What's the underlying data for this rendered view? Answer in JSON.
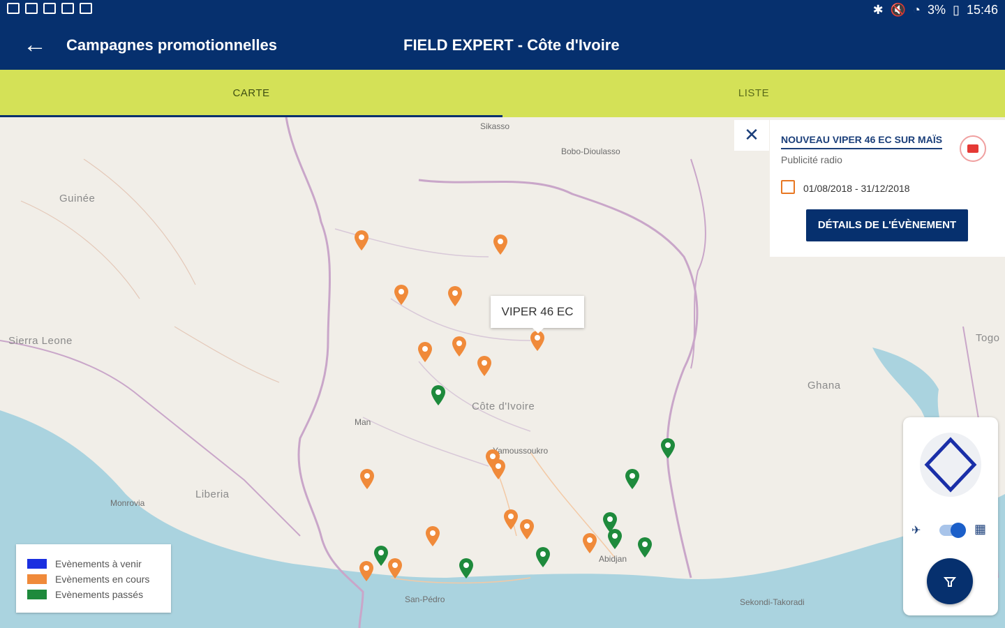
{
  "status_bar": {
    "time": "15:46",
    "battery": "3%"
  },
  "app_bar": {
    "title": "Campagnes promotionnelles",
    "center_title": "FIELD EXPERT - Côte d'Ivoire"
  },
  "tabs": [
    {
      "label": "CARTE",
      "active": true
    },
    {
      "label": "LISTE",
      "active": false
    }
  ],
  "map": {
    "labels": {
      "country_cote": "Côte d'Ivoire",
      "country_ghana": "Ghana",
      "country_guinee": "Guinée",
      "country_sierra": "Sierra Leone",
      "country_liberia": "Liberia",
      "country_togo": "Togo",
      "bobo": "Bobo-Dioulasso",
      "sikasso": "Sikasso",
      "yamoussoukro": "Yamoussoukro",
      "abidjan": "Abidjan",
      "sanpedro": "San-Pédro",
      "monrovia": "Monrovia",
      "man": "Man",
      "sekondi": "Sekondi-Takoradi"
    },
    "tooltip": "VIPER 46 EC"
  },
  "event_panel": {
    "title": "NOUVEAU VIPER 46 EC SUR MAÏS",
    "type": "Publicité radio",
    "dates": "01/08/2018 - 31/12/2018",
    "details_button": "DÉTAILS DE L'ÉVÈNEMENT"
  },
  "legend": [
    {
      "label": "Evènements à venir",
      "color": "#1a2fe0"
    },
    {
      "label": "Evènements en cours",
      "color": "#f08a3a"
    },
    {
      "label": "Evènements passés",
      "color": "#1e8a3c"
    }
  ],
  "colors": {
    "primary": "#06306e",
    "accent": "#d4e157",
    "ongoing": "#f08a3a",
    "past": "#1e8a3c"
  }
}
